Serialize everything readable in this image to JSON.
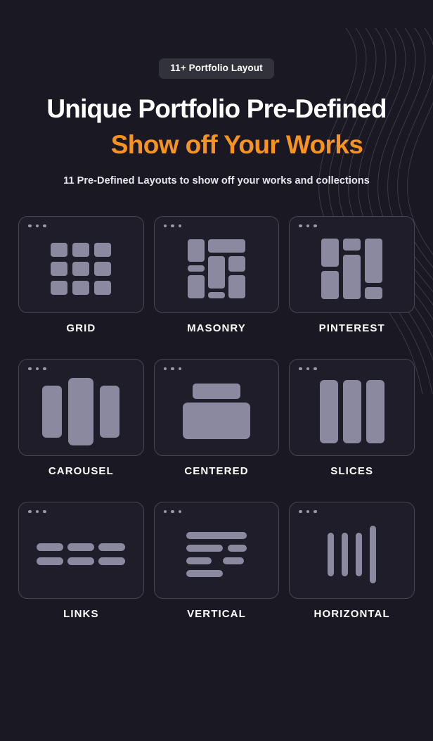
{
  "theme": {
    "background": "#1a1823",
    "accent_orange": "#f7931e",
    "block_fill": "#8b89a0",
    "card_border": "#474551",
    "card_bg": "#1f1d29",
    "badge_bg": "#32323c",
    "text_white": "#ffffff"
  },
  "hero": {
    "badge": "11+ Portfolio Layout",
    "title_line1": "Unique Portfolio Pre-Defined",
    "title_line2": "Show off Your Works",
    "subtitle": "11 Pre-Defined Layouts to show off your works and collections"
  },
  "layouts": [
    {
      "id": "grid",
      "label": "GRID",
      "icon": "grid-layout-icon"
    },
    {
      "id": "masonry",
      "label": "MASONRY",
      "icon": "masonry-layout-icon"
    },
    {
      "id": "pinterest",
      "label": "PINTEREST",
      "icon": "pinterest-layout-icon"
    },
    {
      "id": "carousel",
      "label": "CAROUSEL",
      "icon": "carousel-layout-icon"
    },
    {
      "id": "centered",
      "label": "CENTERED",
      "icon": "centered-layout-icon"
    },
    {
      "id": "slices",
      "label": "SLICES",
      "icon": "slices-layout-icon"
    },
    {
      "id": "links",
      "label": "LINKS",
      "icon": "links-layout-icon"
    },
    {
      "id": "vertical",
      "label": "VERTICAL",
      "icon": "vertical-layout-icon"
    },
    {
      "id": "horizontal",
      "label": "HORIZONTAL",
      "icon": "horizontal-layout-icon"
    }
  ]
}
